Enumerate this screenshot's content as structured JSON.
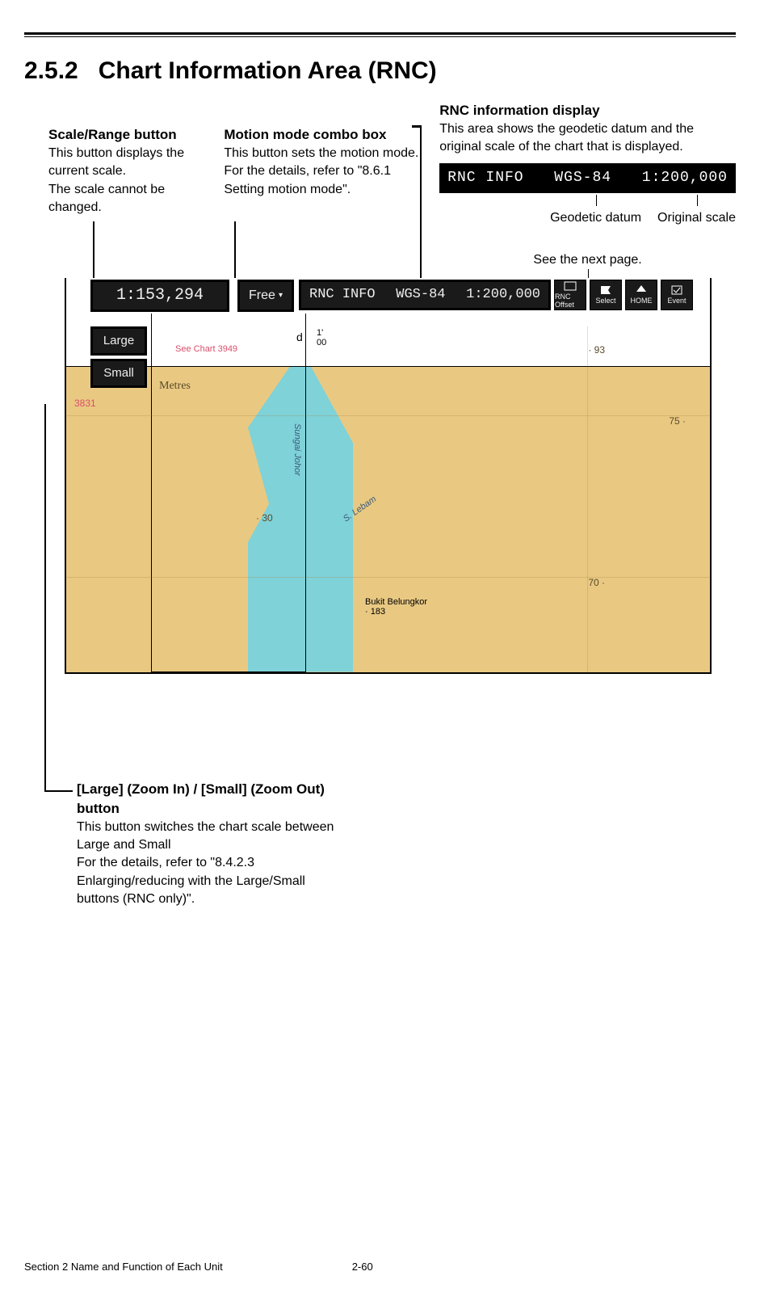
{
  "section_number": "2.5.2",
  "section_title": "Chart Information Area (RNC)",
  "callouts": {
    "scale": {
      "label": "Scale/Range button",
      "body": "This button displays the current scale.\nThe scale cannot be changed."
    },
    "motion": {
      "label": "Motion mode combo box",
      "body": "This button sets the motion mode.\nFor the details, refer to \"8.6.1 Setting motion mode\"."
    },
    "rnc": {
      "label": "RNC information display",
      "body": "This area shows the geodetic datum and the original scale of the chart that is displayed.",
      "sample_prefix": "RNC INFO",
      "sample_datum": "WGS-84",
      "sample_scale": "1:200,000",
      "sub_datum": "Geodetic datum",
      "sub_scale": "Original scale",
      "see_next": "See the next page."
    },
    "zoom": {
      "label": "[Large] (Zoom In) / [Small] (Zoom Out) button",
      "body": "This button switches the chart scale between Large and Small\nFor the details, refer to \"8.4.2.3 Enlarging/reducing with the Large/Small buttons (RNC only)\"."
    }
  },
  "toolbar": {
    "scale_value": "1:153,294",
    "motion_value": "Free",
    "rnc_prefix": "RNC INFO",
    "rnc_datum": "WGS-84",
    "rnc_scale": "1:200,000",
    "large_label": "Large",
    "small_label": "Small",
    "icon_buttons": [
      "RNC Offset",
      "Select",
      "HOME",
      "Event"
    ]
  },
  "map_labels": {
    "metres": "Metres",
    "see_chart": "See Chart 3949",
    "num_3831": "3831",
    "d": "d",
    "tick": "1'\n00",
    "c93": "· 93",
    "c75": "75 ·",
    "c70": "70 ·",
    "c30": "· 30",
    "bukit": "Bukit Belungkor\n· 183",
    "river": "Sungai Johor",
    "river2": "S. Lebam"
  },
  "footer": {
    "section": "Section 2    Name and Function of Each Unit",
    "page": "2-60"
  }
}
